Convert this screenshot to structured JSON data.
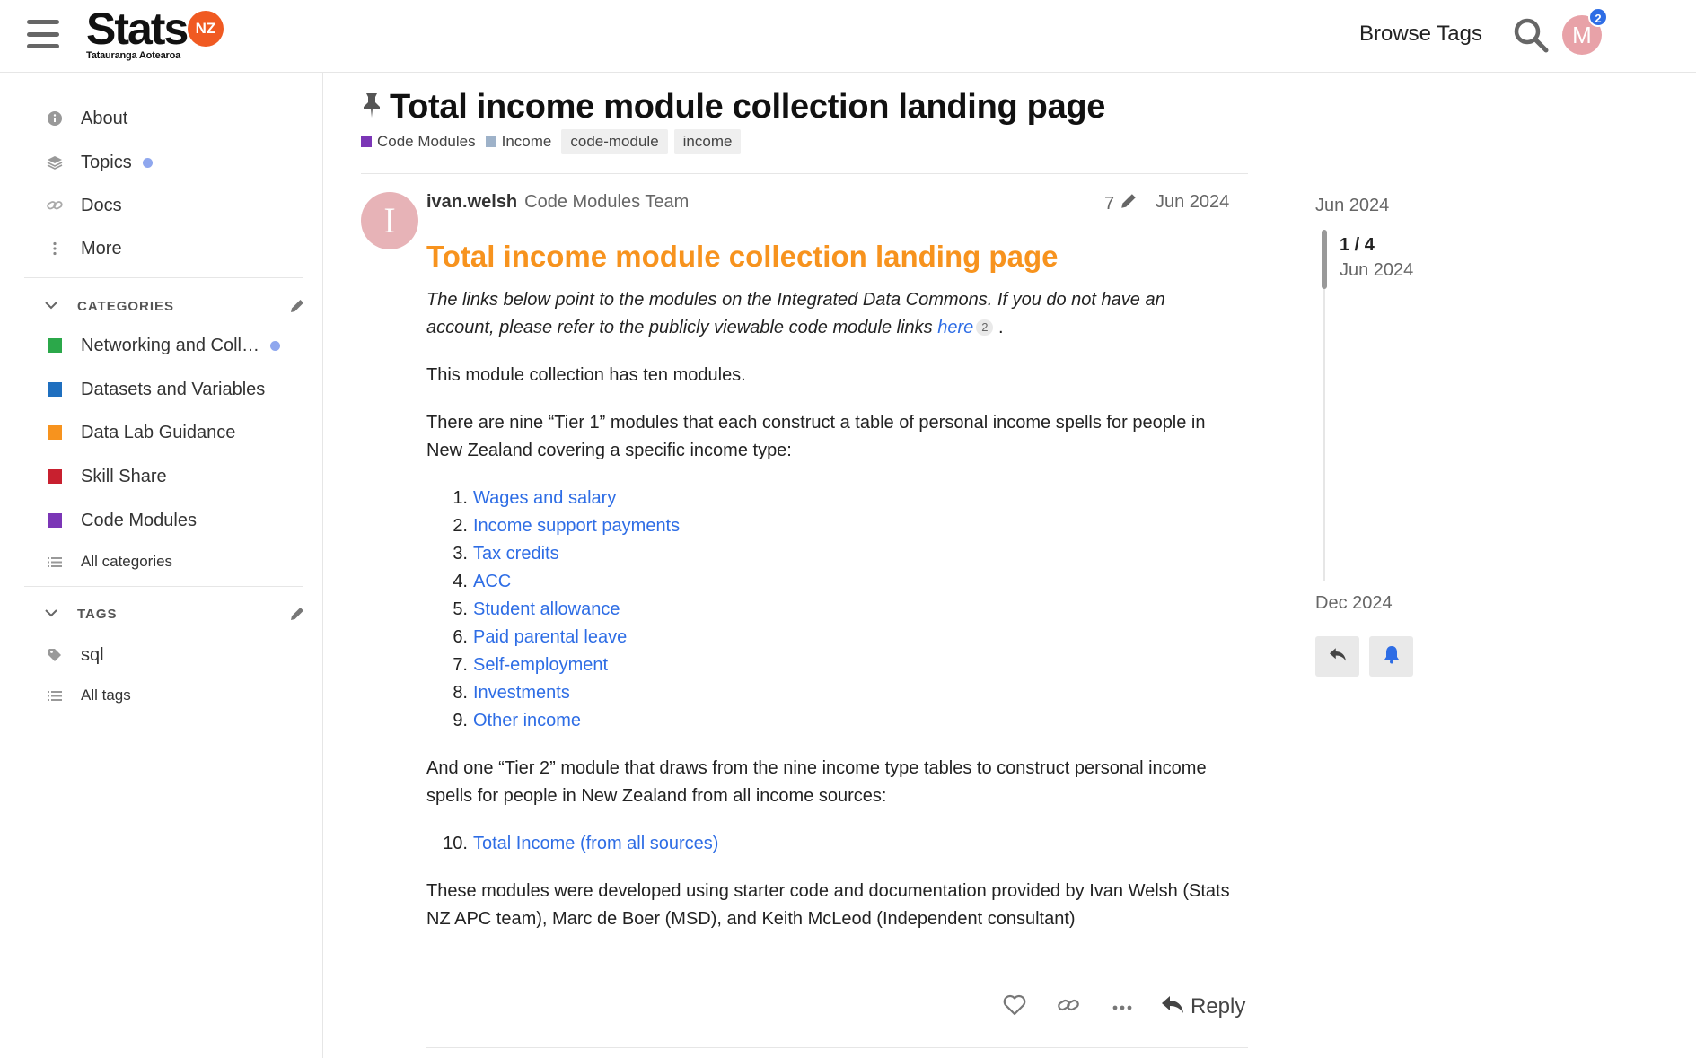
{
  "header": {
    "logo_text": "Stats",
    "logo_badge": "NZ",
    "logo_subtitle": "Tatauranga Aotearoa",
    "browse_tags": "Browse Tags",
    "avatar_letter": "M",
    "notification_count": "2",
    "avatar_color": "#e8a2a8",
    "badge_color": "#2e6de5"
  },
  "sidebar": {
    "links": [
      {
        "label": "About",
        "icon": "info-icon"
      },
      {
        "label": "Topics",
        "icon": "layers-icon",
        "unread_dot": true
      },
      {
        "label": "Docs",
        "icon": "link-icon"
      },
      {
        "label": "More",
        "icon": "more-vertical-icon"
      }
    ],
    "categories_title": "CATEGORIES",
    "categories": [
      {
        "label": "Networking and Coll…",
        "color": "#2ba84a",
        "unread_dot": true
      },
      {
        "label": "Datasets and Variables",
        "color": "#1f6fbf"
      },
      {
        "label": "Data Lab Guidance",
        "color": "#f7931e"
      },
      {
        "label": "Skill Share",
        "color": "#c8202f"
      },
      {
        "label": "Code Modules",
        "color": "#7b36b6"
      }
    ],
    "all_categories": "All categories",
    "tags_title": "TAGS",
    "tags": [
      {
        "label": "sql",
        "icon": "tag-icon"
      }
    ],
    "all_tags": "All tags"
  },
  "topic": {
    "title": "Total income module collection landing page",
    "categories": [
      {
        "label": "Code Modules",
        "color": "#7b36b6"
      },
      {
        "label": "Income",
        "color": "#9eb2c9"
      }
    ],
    "tags": [
      "code-module",
      "income"
    ]
  },
  "post": {
    "avatar_letter": "I",
    "username": "ivan.welsh",
    "user_title": "Code Modules Team",
    "edit_count": "7",
    "date": "Jun 2024",
    "heading": "Total income module collection landing page",
    "intro_text": "The links below point to the modules on the Integrated Data Commons. If you do not have an account, please refer to the publicly viewable code module links ",
    "intro_link": "here",
    "intro_link_clicks": "2",
    "intro_end": ".",
    "para1": "This module collection has ten modules.",
    "para2": "There are nine “Tier 1” modules that each construct a table of personal income spells for people in New Zealand covering a specific income type:",
    "tier1_list": [
      {
        "num": "1.",
        "label": "Wages and salary"
      },
      {
        "num": "2.",
        "label": "Income support payments"
      },
      {
        "num": "3.",
        "label": "Tax credits"
      },
      {
        "num": "4.",
        "label": "ACC"
      },
      {
        "num": "5.",
        "label": "Student allowance"
      },
      {
        "num": "6.",
        "label": "Paid parental leave"
      },
      {
        "num": "7.",
        "label": "Self-employment"
      },
      {
        "num": "8.",
        "label": "Investments"
      },
      {
        "num": "9.",
        "label": "Other income"
      }
    ],
    "para3": "And one “Tier 2” module that draws from the nine income type tables to construct personal income spells for people in New Zealand from all income sources:",
    "tier2_list": [
      {
        "num": "10.",
        "label": "Total Income (from all sources)"
      }
    ],
    "para4": "These modules were developed using starter code and documentation provided by Ivan Welsh (Stats NZ APC team), Marc de Boer (MSD), and Keith McLeod (Independent consultant)",
    "reply_label": "Reply",
    "heading_color": "#f7931e",
    "link_color": "#2e6de5"
  },
  "timeline": {
    "start_date": "Jun 2024",
    "position": "1 / 4",
    "position_date": "Jun 2024",
    "end_date": "Dec 2024"
  }
}
